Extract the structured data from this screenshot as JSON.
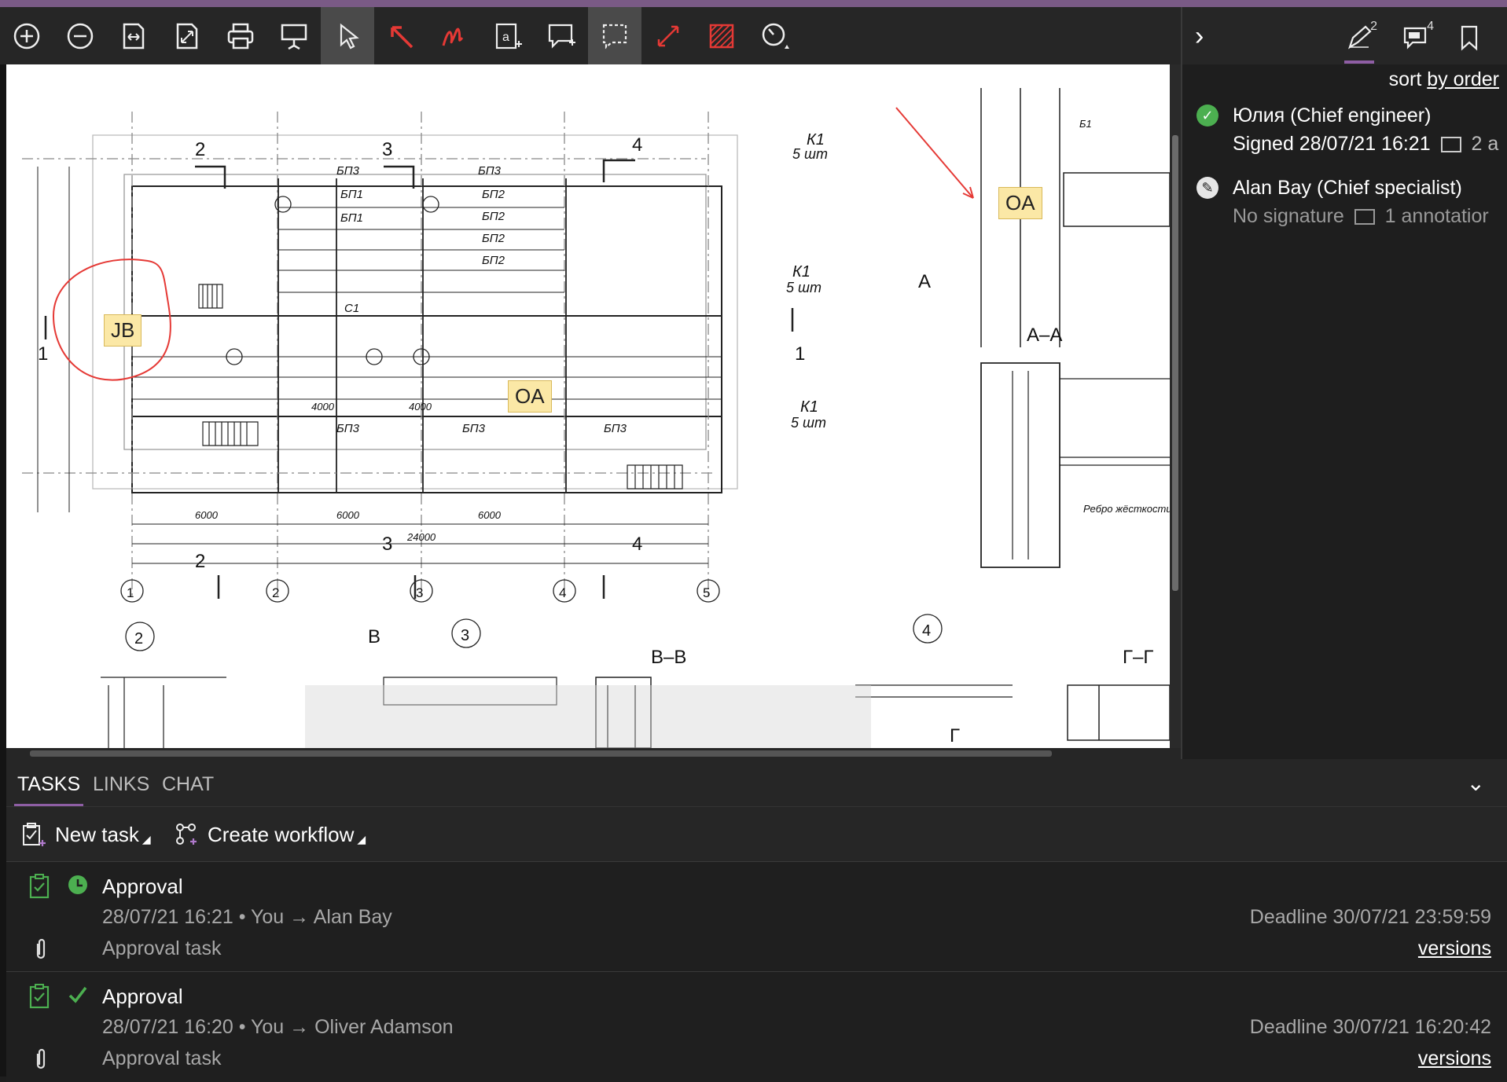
{
  "toolbar": {
    "buttons": [
      "zoom-in",
      "zoom-out",
      "fit-width",
      "fit-page",
      "print",
      "presentation",
      "select",
      "arrow",
      "freehand",
      "text-box",
      "comment",
      "area-select",
      "measure",
      "hatch",
      "more"
    ]
  },
  "drawing": {
    "stamps": {
      "jb": "JB",
      "oa1": "OA",
      "oa2": "OA"
    },
    "labels": {
      "sec2": "2",
      "sec3": "3",
      "sec4": "4",
      "k1a": "К1",
      "k1a_sub": "5 шт",
      "k1b": "К1",
      "k1b_sub": "5 шт",
      "k1c": "К1",
      "k1c_sub": "5 шт",
      "aa": "А–А",
      "a": "А",
      "bb": "В–В",
      "b": "В",
      "gg": "Г–Г",
      "g": "Г",
      "one": "1",
      "dim6000a": "6000",
      "dim6000b": "6000",
      "dim6000c": "6000",
      "dim24000": "24000",
      "dim4000a": "4000",
      "dim4000b": "4000",
      "axis1": "1",
      "axis2": "2",
      "axis3": "3",
      "axis4": "4",
      "axis5": "5",
      "bp3": "БП3",
      "bp1": "БП1",
      "bp2": "БП2",
      "b1": "Б1",
      "c1": "С1",
      "rebro": "Ребро жёсткости"
    }
  },
  "sidebar": {
    "sort_prefix": "sort",
    "sort_link": "by order",
    "tab_sign_count": "2",
    "tab_annot_count": "4",
    "signers": [
      {
        "name": "Юлия (Chief engineer)",
        "status": "Signed 28/07/21 16:21",
        "annot": "2 a"
      },
      {
        "name": "Alan Bay (Chief specialist)",
        "status": "No signature",
        "annot": "1 annotatior"
      }
    ]
  },
  "bottom": {
    "tabs": [
      "TASKS",
      "LINKS",
      "CHAT"
    ],
    "new_task": "New task",
    "create_workflow": "Create workflow",
    "tasks": [
      {
        "title": "Approval",
        "meta": "28/07/21   16:21 • You → Alan Bay",
        "desc": "Approval task",
        "deadline": "Deadline 30/07/21 23:59:59",
        "versions": "versions"
      },
      {
        "title": "Approval",
        "meta": "28/07/21   16:20 • You → Oliver Adamson",
        "desc": "Approval task",
        "deadline": "Deadline 30/07/21 16:20:42",
        "versions": "versions"
      }
    ]
  },
  "colors": {
    "accent": "#8e5ea4",
    "success": "#4caf50",
    "annotation_red": "#e53935",
    "stamp": "#fbe8a6"
  }
}
